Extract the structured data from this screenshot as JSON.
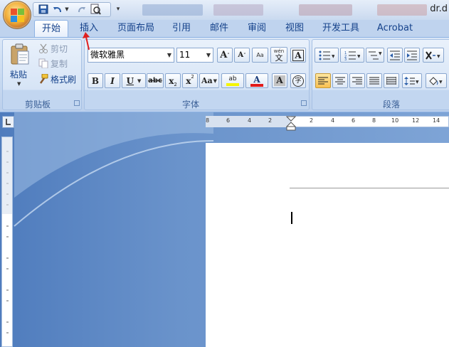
{
  "window": {
    "filename": "dr.d"
  },
  "tabs": [
    {
      "label": "开始",
      "active": true
    },
    {
      "label": "插入"
    },
    {
      "label": "页面布局"
    },
    {
      "label": "引用"
    },
    {
      "label": "邮件"
    },
    {
      "label": "审阅"
    },
    {
      "label": "视图"
    },
    {
      "label": "开发工具"
    },
    {
      "label": "Acrobat"
    }
  ],
  "clipboard": {
    "group_label": "剪贴板",
    "paste_label": "粘贴",
    "cut_label": "剪切",
    "copy_label": "复制",
    "format_painter_label": "格式刷"
  },
  "font": {
    "group_label": "字体",
    "font_name": "微软雅黑",
    "font_size": "11",
    "grow_glyph": "A",
    "shrink_glyph": "A",
    "clear_glyph": "Aa",
    "phonetic_glyph": "wén",
    "phonetic_char": "文",
    "border_glyph": "A",
    "bold": "B",
    "italic": "I",
    "underline": "U",
    "strike": "abc",
    "subscript": "x",
    "superscript": "x",
    "sub_mark": "2",
    "sup_mark": "2",
    "change_case": "Aa",
    "highlight_glyph": "ab",
    "font_color_glyph": "A",
    "shading_glyph": "A",
    "enclose_char": "字"
  },
  "paragraph": {
    "group_label": "段落"
  },
  "colors": {
    "highlight": "#f5f500",
    "font_color": "#e21b1b",
    "arrow": "#e02020"
  },
  "ruler": {
    "h_left": [
      "8",
      "6",
      "4",
      "2"
    ],
    "h_right": [
      "2",
      "4",
      "6",
      "8",
      "10",
      "12",
      "14"
    ]
  }
}
